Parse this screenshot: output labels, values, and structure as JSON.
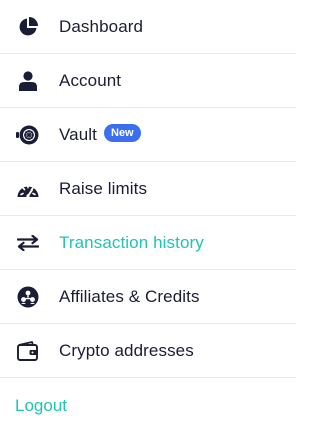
{
  "menu": {
    "items": [
      {
        "label": "Dashboard",
        "icon": "pie-chart-icon"
      },
      {
        "label": "Account",
        "icon": "user-icon"
      },
      {
        "label": "Vault",
        "icon": "vault-icon",
        "badge": "New"
      },
      {
        "label": "Raise limits",
        "icon": "speedometer-icon"
      },
      {
        "label": "Transaction history",
        "icon": "transfer-arrows-icon",
        "active": true
      },
      {
        "label": "Affiliates & Credits",
        "icon": "network-icon"
      },
      {
        "label": "Crypto addresses",
        "icon": "wallet-icon"
      }
    ],
    "logout_label": "Logout"
  },
  "colors": {
    "text": "#1b1c36",
    "accent": "#21c3b4",
    "badge": "#3b6ff0",
    "divider": "#e9eaee"
  }
}
